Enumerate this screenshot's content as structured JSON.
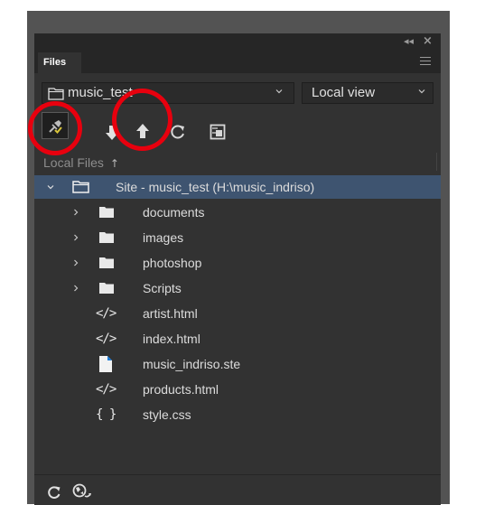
{
  "panel": {
    "tab_label": "Files",
    "site_select": {
      "value": "music_test"
    },
    "view_select": {
      "value": "Local view"
    }
  },
  "toolbar": {
    "buttons": [
      "connect-icon",
      "get-files-icon",
      "put-files-icon",
      "refresh-icon",
      "expand-icon"
    ]
  },
  "local_files": {
    "header": "Local Files",
    "sort_indicator": "↑"
  },
  "tree": {
    "root": "Site - music_test (H:\\music_indriso)",
    "items": [
      {
        "label": "documents",
        "kind": "folder"
      },
      {
        "label": "images",
        "kind": "folder"
      },
      {
        "label": "photoshop",
        "kind": "folder"
      },
      {
        "label": "Scripts",
        "kind": "folder"
      },
      {
        "label": "artist.html",
        "kind": "html",
        "glyph": "</>"
      },
      {
        "label": "index.html",
        "kind": "html",
        "glyph": "</>"
      },
      {
        "label": "music_indriso.ste",
        "kind": "file"
      },
      {
        "label": "products.html",
        "kind": "html",
        "glyph": "</>"
      },
      {
        "label": "style.css",
        "kind": "css",
        "glyph": "{ }"
      }
    ]
  },
  "colors": {
    "panel_bg": "#323232",
    "selected_row": "#3e5470",
    "highlight_circle": "#e8000e",
    "connect_check": "#d8c43a"
  }
}
